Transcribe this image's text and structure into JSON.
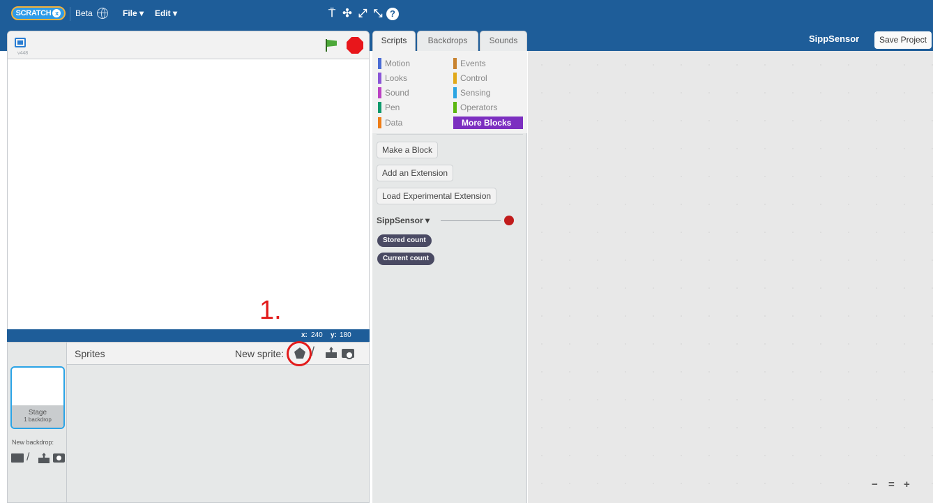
{
  "menubar": {
    "logo_text": "SCRATCH",
    "logo_badge": "x",
    "beta_label": "Beta",
    "file_menu": "File ▾",
    "edit_menu": "Edit ▾",
    "tools": {
      "duplicate": "⍑",
      "delete": "✣",
      "grow": "⤢",
      "shrink": "⤡",
      "help": "?"
    }
  },
  "stage": {
    "version": "v448",
    "coords": {
      "x_label": "x:",
      "x": "240",
      "y_label": "y:",
      "y": "180"
    },
    "annotation": "1."
  },
  "sprites": {
    "title": "Sprites",
    "new_sprite_label": "New sprite:",
    "stage_thumb": {
      "name": "Stage",
      "count": "1 backdrop"
    },
    "new_backdrop_label": "New backdrop:"
  },
  "tabs": [
    {
      "label": "Scripts",
      "active": true
    },
    {
      "label": "Backdrops",
      "active": false
    },
    {
      "label": "Sounds",
      "active": false
    }
  ],
  "project": {
    "title": "SippSensor",
    "save_label": "Save Project"
  },
  "categories": [
    {
      "label": "Motion",
      "color": "#4a6cd4"
    },
    {
      "label": "Looks",
      "color": "#8a55d7"
    },
    {
      "label": "Sound",
      "color": "#bb42c3"
    },
    {
      "label": "Pen",
      "color": "#0e9a6c"
    },
    {
      "label": "Data",
      "color": "#ee7d16"
    },
    {
      "label": "Events",
      "color": "#c88330"
    },
    {
      "label": "Control",
      "color": "#e1a91a"
    },
    {
      "label": "Sensing",
      "color": "#2ca5e2"
    },
    {
      "label": "Operators",
      "color": "#5cb712"
    },
    {
      "label": "More Blocks",
      "color": "#632d99"
    }
  ],
  "palette": {
    "make_block": "Make a Block",
    "add_extension": "Add an Extension",
    "load_experimental": "Load Experimental Extension",
    "extension_name": "SippSensor ▾",
    "reporters": [
      "Stored count",
      "Current count"
    ]
  },
  "zoom": {
    "out": "−",
    "reset": "=",
    "in": "+"
  }
}
